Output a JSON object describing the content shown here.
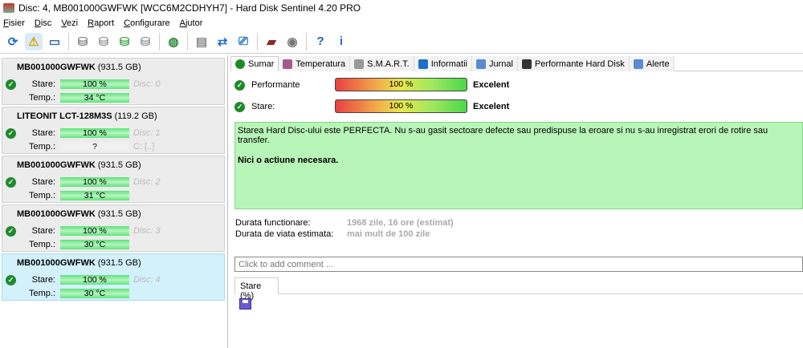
{
  "window": {
    "title": "Disc: 4, MB001000GWFWK [WCC6M2CDHYH7]  -  Hard Disk Sentinel 4.20 PRO"
  },
  "menu": [
    "Fisier",
    "Disc",
    "Vezi",
    "Raport",
    "Configurare",
    "Ajutor"
  ],
  "toolbar": [
    {
      "icon": "refresh-icon",
      "g": "⟳",
      "c": "#1e6fc9"
    },
    {
      "icon": "alert-icon",
      "g": "⚠",
      "c": "#d9a600"
    },
    {
      "icon": "disk-icon",
      "g": "▭",
      "c": "#3a6ea8"
    },
    null,
    {
      "icon": "disk-gray-icon",
      "g": "⛁",
      "c": "#888"
    },
    {
      "icon": "disk-clock-icon",
      "g": "⛁",
      "c": "#999"
    },
    {
      "icon": "disk-check-icon",
      "g": "⛁",
      "c": "#4a4"
    },
    {
      "icon": "disk-search-icon",
      "g": "⛁",
      "c": "#999"
    },
    null,
    {
      "icon": "globe-icon",
      "g": "◍",
      "c": "#2a8a3a"
    },
    null,
    {
      "icon": "document-icon",
      "g": "▤",
      "c": "#888"
    },
    {
      "icon": "sync-icon",
      "g": "⇄",
      "c": "#1e6fc9"
    },
    {
      "icon": "network-icon",
      "g": "⎚",
      "c": "#2a7ac9"
    },
    null,
    {
      "icon": "laptop-icon",
      "g": "▰",
      "c": "#8a2a2a"
    },
    {
      "icon": "speaker-icon",
      "g": "◉",
      "c": "#777"
    },
    null,
    {
      "icon": "help-icon",
      "g": "?",
      "c": "#1e5fb0"
    },
    {
      "icon": "info-icon",
      "g": "i",
      "c": "#1e6fc9"
    }
  ],
  "disks": [
    {
      "name": "MB001000GWFWK",
      "size": "(931.5 GB)",
      "stare_label": "Stare:",
      "stare": "100 %",
      "temp_label": "Temp.:",
      "temp": "34 °C",
      "disc": "Disc: 0"
    },
    {
      "name": "LITEONIT LCT-128M3S",
      "size": "(119.2 GB)",
      "stare_label": "Stare:",
      "stare": "100 %",
      "temp_label": "Temp.:",
      "temp": "?",
      "disc": "Disc: 1",
      "drive": "C: [..]"
    },
    {
      "name": "MB001000GWFWK",
      "size": "(931.5 GB)",
      "stare_label": "Stare:",
      "stare": "100 %",
      "temp_label": "Temp.:",
      "temp": "31 °C",
      "disc": "Disc: 2"
    },
    {
      "name": "MB001000GWFWK",
      "size": "(931.5 GB)",
      "stare_label": "Stare:",
      "stare": "100 %",
      "temp_label": "Temp.:",
      "temp": "30 °C",
      "disc": "Disc: 3"
    },
    {
      "name": "MB001000GWFWK",
      "size": "(931.5 GB)",
      "stare_label": "Stare:",
      "stare": "100 %",
      "temp_label": "Temp.:",
      "temp": "30 °C",
      "disc": "Disc: 4"
    }
  ],
  "tabs": [
    {
      "label": "Sumar",
      "c": "#1e8a2a"
    },
    {
      "label": "Temperatura",
      "c": "#a45a8a"
    },
    {
      "label": "S.M.A.R.T.",
      "c": "#999"
    },
    {
      "label": "Informatii",
      "c": "#1e6fc9"
    },
    {
      "label": "Jurnal",
      "c": "#5a8ad0"
    },
    {
      "label": "Performante Hard Disk",
      "c": "#333"
    },
    {
      "label": "Alerte",
      "c": "#5a8ad0"
    }
  ],
  "summary": {
    "performance": {
      "label": "Performante",
      "value": "100 %",
      "percent": 100,
      "rating": "Excelent"
    },
    "health": {
      "label": "Stare:",
      "value": "100 %",
      "percent": 100,
      "rating": "Excelent"
    },
    "message": "Starea Hard Disc-ului este PERFECTA. Nu s-au gasit sectoare defecte sau predispuse la eroare si nu s-au inregistrat erori de rotire sau transfer.",
    "action": "Nici o actiune necesara.",
    "uptime_label": "Durata functionare:",
    "uptime": "1968 zile, 16 ore (estimat)",
    "lifetime_label": "Durata de viata estimata:",
    "lifetime": "mai mult de 100 zile",
    "comment_placeholder": "Click to add comment ...",
    "chart_tab": "Stare (%)"
  }
}
